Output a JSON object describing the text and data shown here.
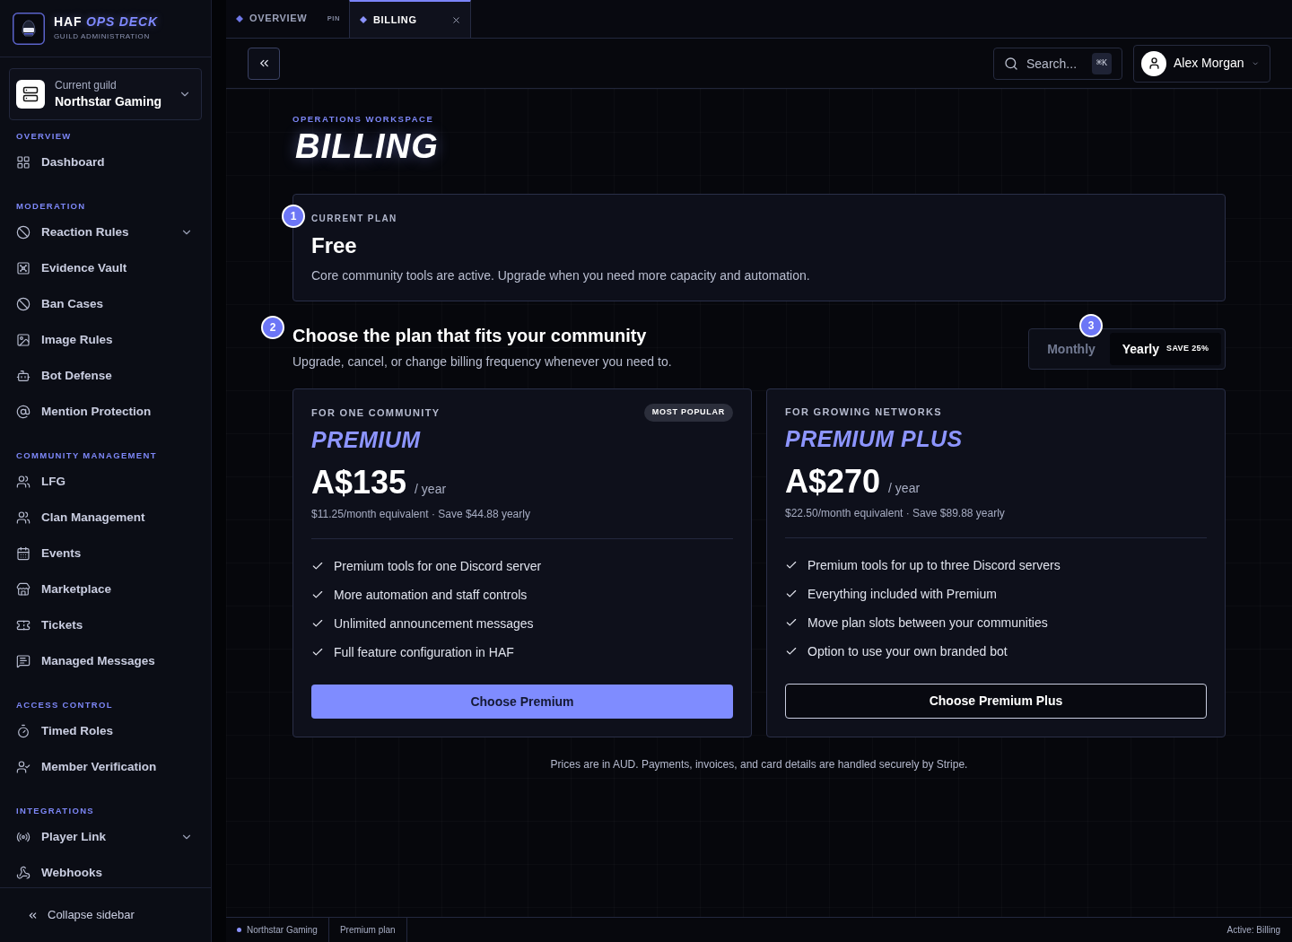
{
  "sidebar": {
    "brand": {
      "name": "HAF",
      "accent": "OPS DECK",
      "subtitle": "GUILD ADMINISTRATION"
    },
    "guild_switcher": {
      "label": "Current guild",
      "value": "Northstar Gaming"
    },
    "sections": [
      {
        "title": "OVERVIEW",
        "items": [
          {
            "label": "Dashboard",
            "kind": "link",
            "selected": false
          }
        ]
      },
      {
        "title": "MODERATION",
        "items": [
          {
            "label": "Reaction Rules",
            "kind": "group",
            "selected": false
          },
          {
            "label": "Evidence Vault",
            "kind": "link",
            "selected": false
          },
          {
            "label": "Ban Cases",
            "kind": "link",
            "selected": false
          },
          {
            "label": "Image Rules",
            "kind": "link",
            "selected": false
          },
          {
            "label": "Bot Defense",
            "kind": "link",
            "selected": false
          },
          {
            "label": "Mention Protection",
            "kind": "link",
            "selected": false
          }
        ]
      },
      {
        "title": "COMMUNITY MANAGEMENT",
        "items": [
          {
            "label": "LFG",
            "kind": "link",
            "selected": false
          },
          {
            "label": "Clan Management",
            "kind": "link",
            "selected": false
          },
          {
            "label": "Events",
            "kind": "link",
            "selected": false
          },
          {
            "label": "Marketplace",
            "kind": "link",
            "selected": false
          },
          {
            "label": "Tickets",
            "kind": "link",
            "selected": false
          },
          {
            "label": "Managed Messages",
            "kind": "link",
            "selected": false
          }
        ]
      },
      {
        "title": "ACCESS CONTROL",
        "items": [
          {
            "label": "Timed Roles",
            "kind": "link",
            "selected": false
          },
          {
            "label": "Member Verification",
            "kind": "link",
            "selected": false
          }
        ]
      },
      {
        "title": "INTEGRATIONS",
        "items": [
          {
            "label": "Player Link",
            "kind": "group",
            "selected": false
          },
          {
            "label": "Webhooks",
            "kind": "link",
            "selected": false
          }
        ]
      }
    ],
    "collapse_label": "Collapse sidebar"
  },
  "tabs": [
    {
      "label": "OVERVIEW",
      "selected": false,
      "kind": "pinned",
      "pin_label": "PIN"
    },
    {
      "label": "BILLING",
      "selected": true,
      "kind": "closable"
    }
  ],
  "header": {
    "search": {
      "placeholder": "Search...",
      "shortcut": "⌘K"
    },
    "user": {
      "name": "Alex Morgan"
    }
  },
  "page": {
    "eyebrow": "OPERATIONS WORKSPACE",
    "title": "BILLING"
  },
  "current_plan": {
    "step": "1",
    "label": "CURRENT PLAN",
    "name": "Free",
    "description": "Core community tools are active. Upgrade when you need more capacity and automation."
  },
  "plan_picker": {
    "step": "2",
    "title": "Choose the plan that fits your community",
    "subtitle": "Upgrade, cancel, or change billing frequency whenever you need to.",
    "billing_toggle": {
      "step": "3",
      "options": [
        {
          "label": "Monthly",
          "selected": false
        },
        {
          "label": "Yearly",
          "selected": true,
          "badge": "SAVE 25%"
        }
      ]
    }
  },
  "plans": [
    {
      "eyebrow": "FOR ONE COMMUNITY",
      "badge": "MOST POPULAR",
      "name": "PREMIUM",
      "price": "A$135",
      "period": "/ year",
      "note": "$11.25/month equivalent · Save $44.88 yearly",
      "features": [
        "Premium tools for one Discord server",
        "More automation and staff controls",
        "Unlimited announcement messages",
        "Full feature configuration in HAF"
      ],
      "button": {
        "label": "Choose Premium",
        "kind": "primary"
      }
    },
    {
      "eyebrow": "FOR GROWING NETWORKS",
      "name": "PREMIUM PLUS",
      "price": "A$270",
      "period": "/ year",
      "note": "$22.50/month equivalent · Save $89.88 yearly",
      "features": [
        "Premium tools for up to three Discord servers",
        "Everything included with Premium",
        "Move plan slots between your communities",
        "Option to use your own branded bot"
      ],
      "button": {
        "label": "Choose Premium Plus",
        "kind": "outline"
      }
    }
  ],
  "footnote": "Prices are in AUD. Payments, invoices, and card details are handled securely by Stripe.",
  "status_bar": {
    "items": [
      {
        "label": "Northstar Gaming",
        "kind": "dot"
      },
      {
        "label": "Premium plan",
        "kind": "plain"
      }
    ],
    "active": "Active: Billing"
  }
}
